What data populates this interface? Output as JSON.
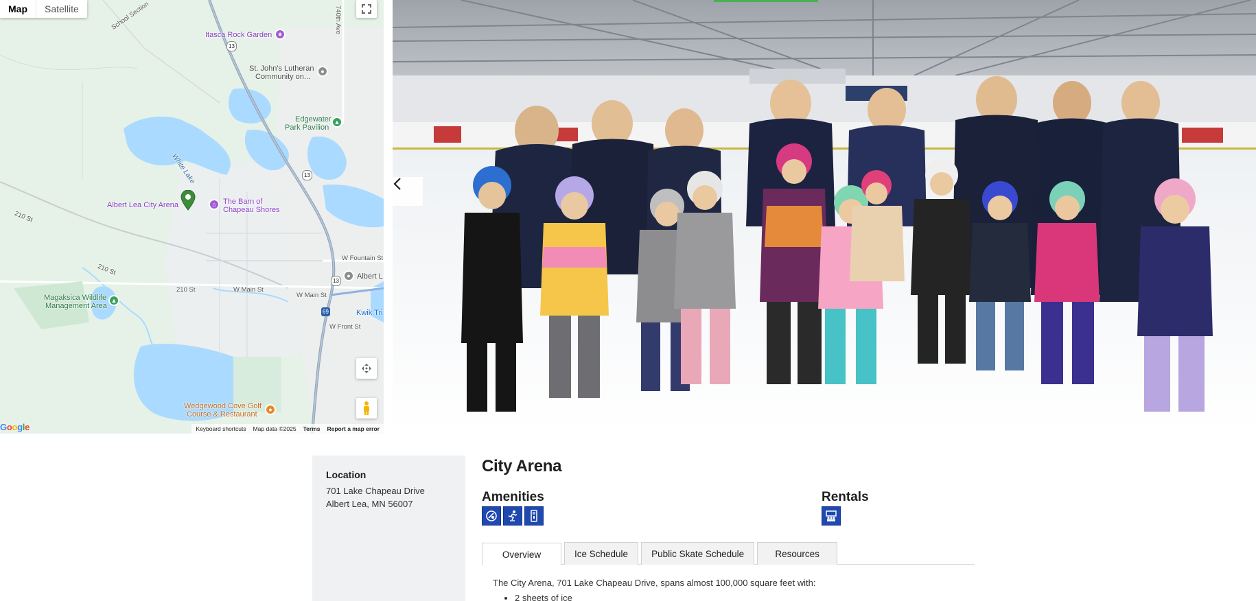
{
  "map": {
    "toggle": {
      "map_label": "Map",
      "satellite_label": "Satellite"
    },
    "labels": {
      "itasca": "Itasca Rock Garden",
      "st_johns_1": "St. John's Lutheran",
      "st_johns_2": "Community on...",
      "edgewater_1": "Edgewater",
      "edgewater_2": "Park Pavilion",
      "white_lake": "White Lake",
      "city_arena": "Albert Lea City Arena",
      "barn_1": "The Barn of",
      "barn_2": "Chapeau Shores",
      "school_section": "School Section",
      "wfountain": "W Fountain St",
      "albert_l": "Albert L",
      "wmain_1": "210 St",
      "wmain_2": "W Main St",
      "wmain_3": "W Main St",
      "st210_a": "210 St",
      "st210_b": "210 St",
      "kwik": "Kwik Tri",
      "wfront": "W Front St",
      "magaksica_1": "Magaksica Wildlife",
      "magaksica_2": "Management Area",
      "wedgewood_1": "Wedgewood Cove Golf",
      "wedgewood_2": "Course & Restaurant",
      "ave740": "740th Ave",
      "hwy13": "13",
      "hwy13b": "13",
      "hwy13c": "13",
      "hwy69": "69"
    },
    "footer": {
      "shortcuts": "Keyboard shortcuts",
      "data": "Map data ©2025",
      "terms": "Terms",
      "report": "Report a map error"
    },
    "logo": "Google"
  },
  "sidebar": {
    "location_heading": "Location",
    "address_line1": "701 Lake Chapeau Drive",
    "address_line2": "Albert Lea, MN 56007"
  },
  "main": {
    "title": "City Arena",
    "amenities_heading": "Amenities",
    "rentals_heading": "Rentals",
    "amenity_icons": [
      "hockey-puck-icon",
      "skater-icon",
      "locker-icon"
    ],
    "rental_icons": [
      "meeting-room-icon"
    ],
    "tabs": [
      "Overview",
      "Ice Schedule",
      "Public Skate Schedule",
      "Resources"
    ],
    "active_tab": "Overview",
    "description": "The City Arena, 701 Lake Chapeau Drive, spans almost 100,000 square feet with:",
    "bullets": [
      "2 sheets of ice"
    ]
  },
  "colors": {
    "icon_blue": "#1f49b0",
    "map_bg": "#e3f1e6",
    "water": "#aadaff",
    "progress": "#4caf50"
  }
}
